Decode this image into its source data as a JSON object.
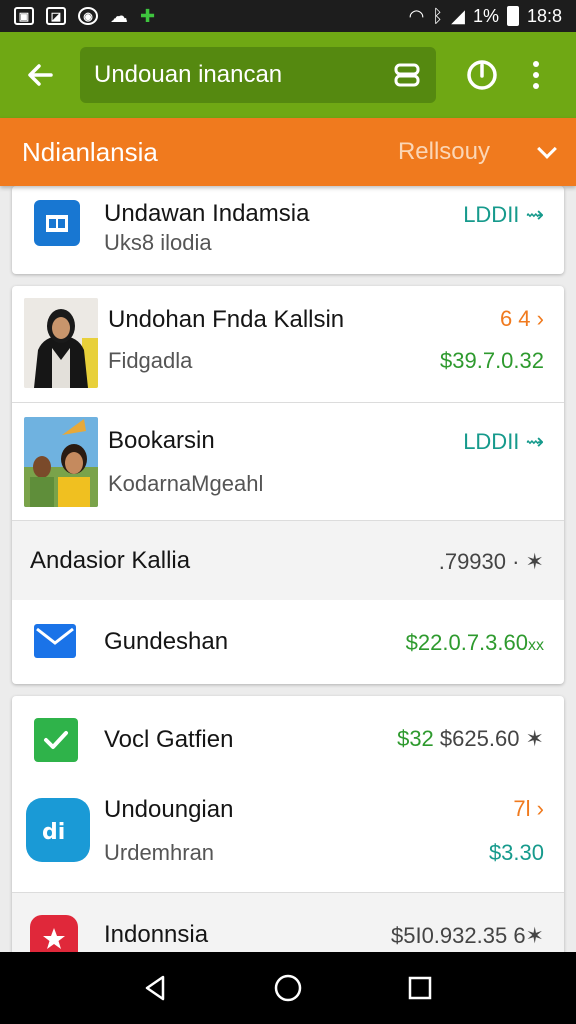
{
  "status_bar": {
    "right_text": "1%",
    "time": "18:8"
  },
  "toolbar": {
    "search_value": "Undouan inancan"
  },
  "region_bar": {
    "title": "Ndianlansia",
    "selector": "Rellsouy"
  },
  "cards": [
    {
      "rows": [
        {
          "title": "Undawan Indamsia",
          "subtitle": "Uks8 ilodia",
          "right": "LDDII",
          "right_arrow": "⇝"
        }
      ]
    },
    {
      "rows": [
        {
          "title": "Undohan Fnda Kallsin",
          "subtitle": "Fidgadla",
          "right_top": "6 4",
          "right_arrow": "›",
          "right_bottom": "$39.7.0.32"
        },
        {
          "title": "Bookarsin",
          "subtitle": "KodarnaMgeahl",
          "right": "LDDII",
          "right_arrow": "⇝"
        },
        {
          "title": "Andasior Kallia",
          "right": ".79930 · ✶"
        },
        {
          "title": "Gundeshan",
          "right": "$22.0.7.3.60",
          "right_suffix": "xx"
        }
      ]
    },
    {
      "rows": [
        {
          "title": "Vocl Gatfien",
          "right_green": "$32",
          "right_dark": "$625.60 ✶"
        },
        {
          "title": "Undoungian",
          "subtitle": "Urdemhran",
          "right_top": "7l",
          "right_arrow": "›",
          "right_bottom": "$3.30"
        },
        {
          "title": "Indonnsia",
          "right": "$5I0.932.35 6✶"
        }
      ]
    }
  ],
  "colors": {
    "toolbar_green": "#6fa814",
    "search_green": "#558910",
    "region_orange": "#f07a1e",
    "price_green": "#2e9a2e",
    "price_teal": "#169a8c"
  },
  "icons": {
    "back": "arrow-left-icon",
    "scan": "scan-icon",
    "power": "power-icon",
    "more": "more-vert-icon"
  }
}
